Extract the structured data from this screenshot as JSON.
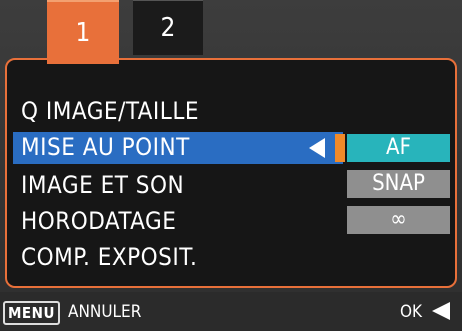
{
  "tabs": [
    {
      "label": "1",
      "active": true
    },
    {
      "label": "2",
      "active": false
    }
  ],
  "menu": {
    "items": [
      {
        "label": "Q IMAGE/TAILLE"
      },
      {
        "label": "MISE AU POINT"
      },
      {
        "label": "IMAGE ET SON"
      },
      {
        "label": "HORODATAGE"
      },
      {
        "label": "COMP. EXPOSIT."
      }
    ],
    "selected_index": 1
  },
  "options": [
    {
      "label": "AF",
      "selected": true
    },
    {
      "label": "SNAP",
      "selected": false
    },
    {
      "label": "∞",
      "selected": false
    }
  ],
  "footer": {
    "menu_key": "MENU",
    "cancel": "ANNULER",
    "ok": "OK"
  },
  "colors": {
    "accent_orange": "#e8703a",
    "highlight_blue": "#2a6dc2",
    "selected_option_teal": "#28b4bb",
    "option_gray": "#8f8f8f"
  },
  "icons": {
    "menu_pointer": "left-triangle-icon",
    "ok_arrow": "left-triangle-icon"
  }
}
